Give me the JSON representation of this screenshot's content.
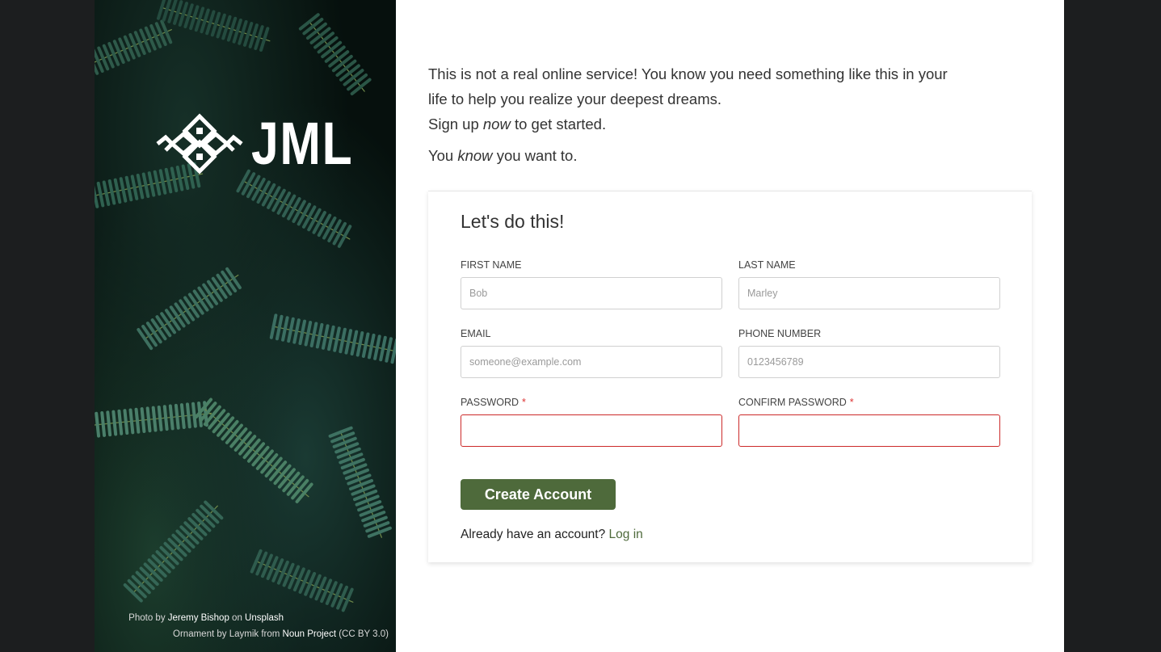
{
  "hero": {
    "logo_text": "JML",
    "credit_photo": {
      "prefix": "Photo by",
      "author": "Jeremy Bishop",
      "mid": "on",
      "site": "Unsplash"
    },
    "credit_ornament": {
      "prefix": "Ornament by Laymik from",
      "site": "Noun Project",
      "license": "(CC BY 3.0)"
    }
  },
  "intro": {
    "line1": "This is not a real online service! You know you need something like this in your",
    "line2": "life to help you realize your deepest dreams.",
    "line3_a": "Sign up ",
    "line3_em": "now",
    "line3_b": " to get started.",
    "line4_a": "You ",
    "line4_em": "know",
    "line4_b": " you want to."
  },
  "form": {
    "title": "Let's do this!",
    "first_name": {
      "label": "FIRST NAME",
      "placeholder": "Bob",
      "value": ""
    },
    "last_name": {
      "label": "LAST NAME",
      "placeholder": "Marley",
      "value": ""
    },
    "email": {
      "label": "EMAIL",
      "placeholder": "someone@example.com",
      "value": ""
    },
    "phone": {
      "label": "PHONE NUMBER",
      "placeholder": "0123456789",
      "value": ""
    },
    "password": {
      "label": "PASSWORD",
      "required_mark": "*",
      "value": ""
    },
    "confirm_password": {
      "label": "CONFIRM PASSWORD",
      "required_mark": "*",
      "value": ""
    },
    "submit_label": "Create Account",
    "login_prompt": "Already have an account? ",
    "login_link": "Log in"
  },
  "colors": {
    "accent": "#4e6a3b",
    "error": "#cc2a2a",
    "backdrop": "#1c1e1f"
  }
}
